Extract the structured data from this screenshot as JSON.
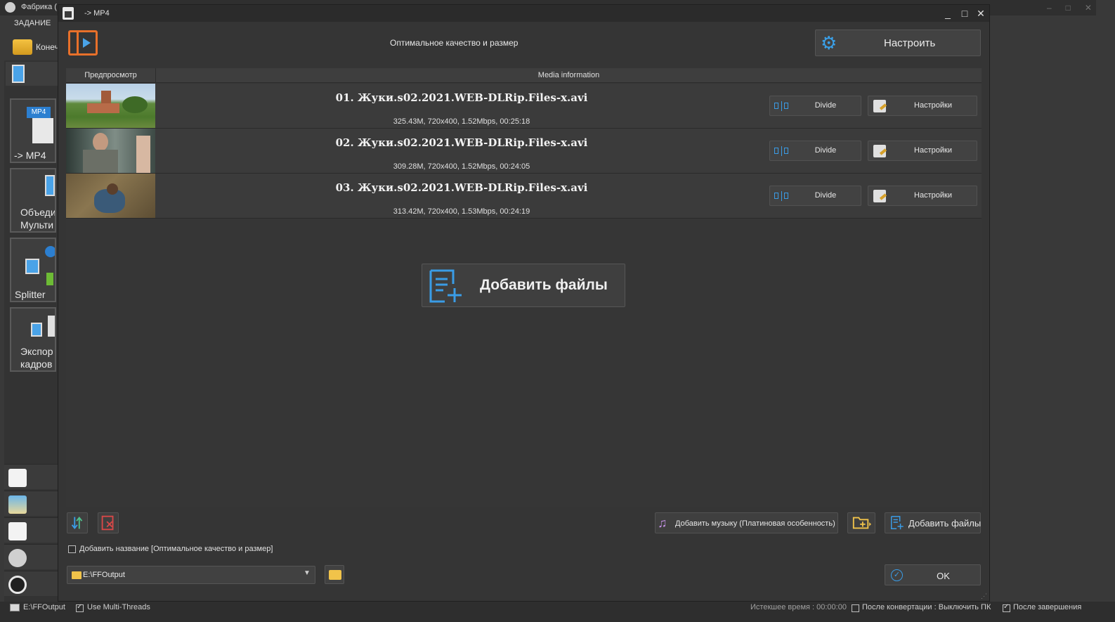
{
  "background_app": {
    "title": "Фабрика (",
    "menu_item": "ЗАДАНИЕ",
    "toolbar_label": "Конеч",
    "categories": [
      {
        "label_line1": "-> MP4",
        "badge": "MP4"
      },
      {
        "label_line1": "Объеди",
        "label_line2": "Мульти"
      },
      {
        "label_line1": "Splitter"
      },
      {
        "label_line1": "Экспор",
        "label_line2": "кадров"
      }
    ]
  },
  "dialog": {
    "title": "-> MP4",
    "subtitle": "Оптимальное качество и размер",
    "configure_label": "Настроить",
    "list_headers": {
      "preview": "Предпросмотр",
      "info": "Media information"
    },
    "files": [
      {
        "title": "01. Жуки.s02.2021.WEB-DLRip.Files-x.avi",
        "meta": "325.43M, 720x400, 1.52Mbps, 00:25:18",
        "divide_label": "Divide",
        "settings_label": "Настройки"
      },
      {
        "title": "02. Жуки.s02.2021.WEB-DLRip.Files-x.avi",
        "meta": "309.28M, 720x400, 1.52Mbps, 00:24:05",
        "divide_label": "Divide",
        "settings_label": "Настройки"
      },
      {
        "title": "03. Жуки.s02.2021.WEB-DLRip.Files-x.avi",
        "meta": "313.42M, 720x400, 1.53Mbps, 00:24:19",
        "divide_label": "Divide",
        "settings_label": "Настройки"
      }
    ],
    "add_files_big_label": "Добавить файлы",
    "add_music_label": "Добавить музыку (Платиновая особенность)",
    "add_files_small_label": "Добавить файлы",
    "add_name_label": "Добавить название [Оптимальное качество и размер]",
    "add_name_checked": false,
    "output_folder": "E:\\FFOutput",
    "ok_label": "OK"
  },
  "statusbar": {
    "path": "E:\\FFOutput",
    "multithreads_label": "Use Multi-Threads",
    "multithreads_checked": true,
    "elapsed": "Истекшее время : 00:00:00",
    "after_convert": "После конвертации : Выключить ПК",
    "after_done": "После завершения"
  },
  "colors": {
    "accent_blue": "#3a9ce6",
    "accent_orange": "#e8702a",
    "folder_yellow": "#f1c34a",
    "music_purple": "#c08ee0"
  }
}
